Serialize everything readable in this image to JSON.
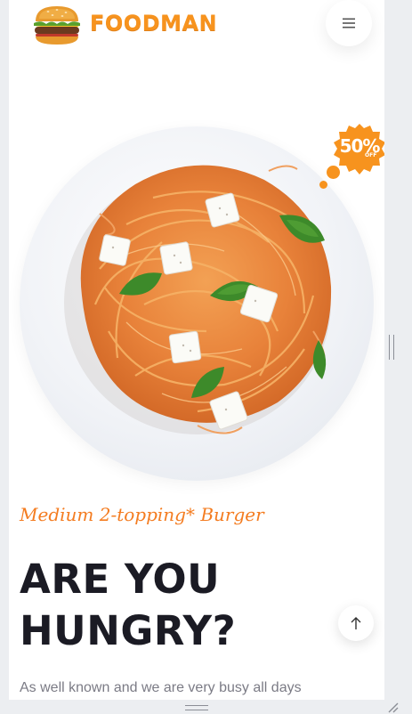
{
  "header": {
    "brand": "FOODMAN",
    "logo_icon": "burger-icon",
    "menu_icon": "hamburger-menu-icon"
  },
  "hero": {
    "image": "spaghetti-plate-image",
    "badge": {
      "value": "50%",
      "suffix": "OFF",
      "color": "#f7931e"
    }
  },
  "content": {
    "subtitle": "Medium 2-topping* Burger",
    "headline_line1": "ARE YOU",
    "headline_line2": "HUNGRY?",
    "description": "As well known and we are very busy all days"
  },
  "controls": {
    "scroll_top_icon": "arrow-up-icon"
  },
  "colors": {
    "accent": "#f7931e",
    "accent_text": "#f47c20",
    "headline": "#1b1b24",
    "body_text": "#7b7b85",
    "background": "#ffffff",
    "frame": "#eceef1"
  }
}
